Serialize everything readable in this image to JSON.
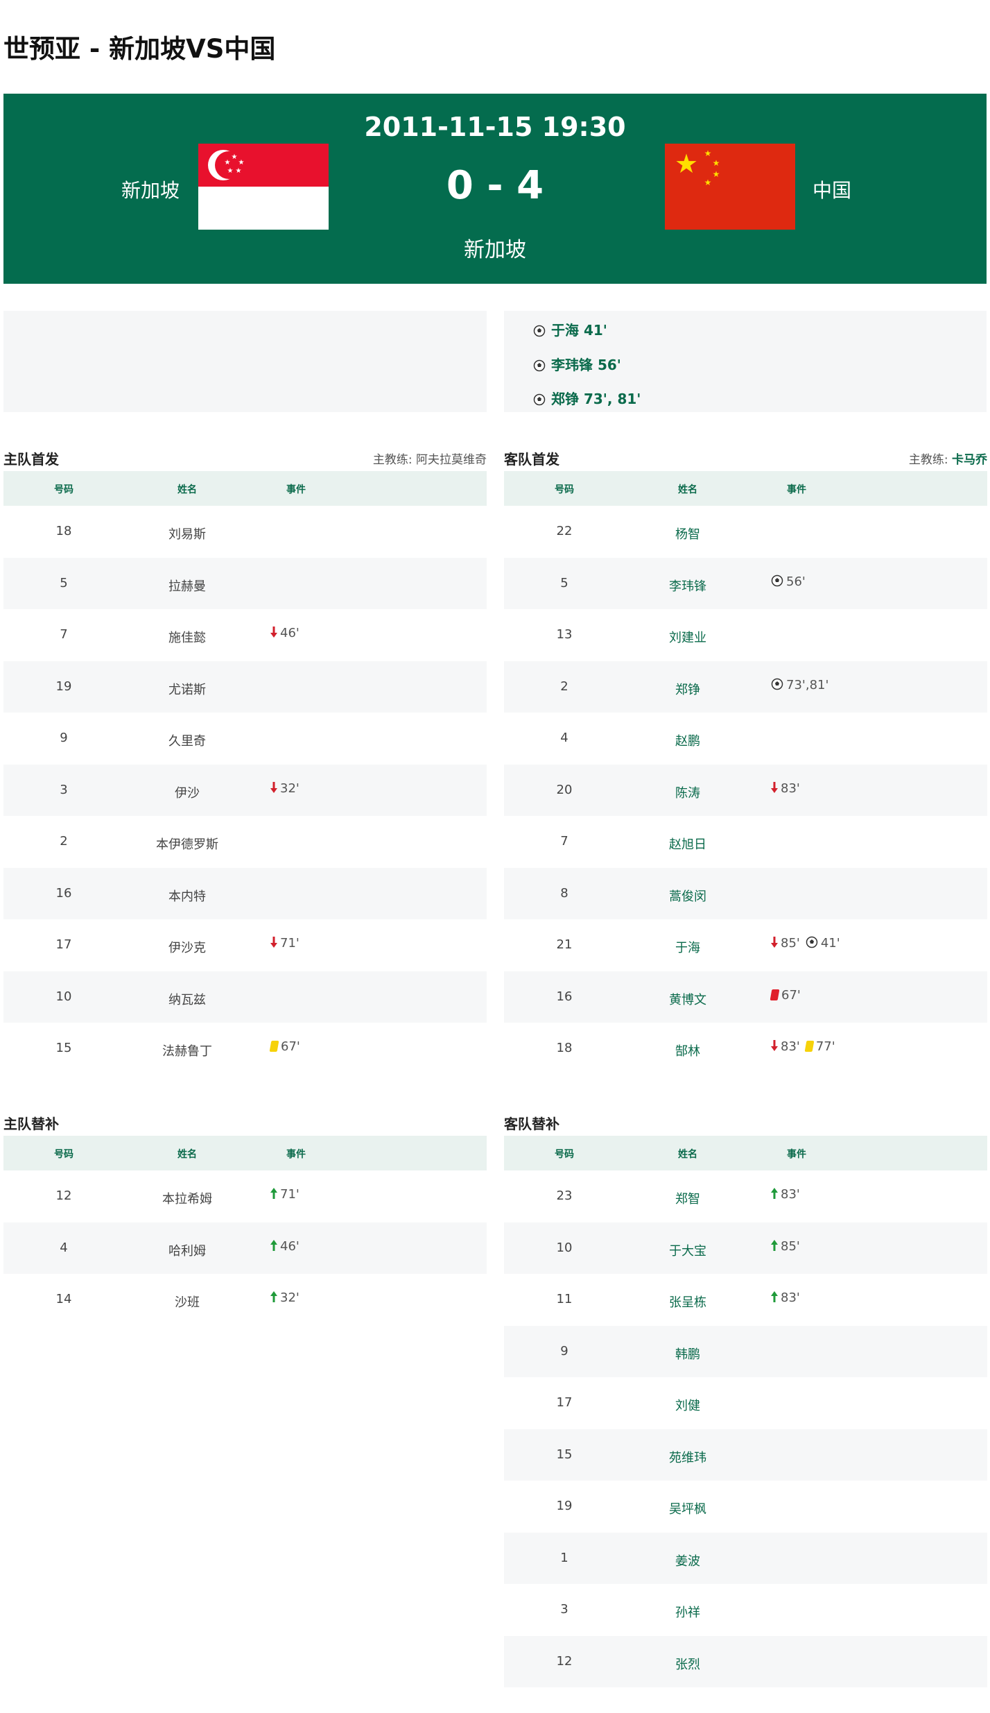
{
  "page_title": "世预亚 - 新加坡VS中国",
  "match": {
    "datetime": "2011-11-15 19:30",
    "score": "0 - 4",
    "venue": "新加坡",
    "home_team": "新加坡",
    "away_team": "中国"
  },
  "colors": {
    "header_bg": "#046c4e",
    "accent": "#0a6a4b",
    "table_head_bg": "#e9f2ef"
  },
  "away_goals": [
    {
      "text": "于海 41'"
    },
    {
      "text": "李玮锋 56'"
    },
    {
      "text": "郑铮 73', 81'"
    }
  ],
  "home_lineup": {
    "title": "主队首发",
    "coach_label": "主教练: 阿夫拉莫维奇",
    "headers": {
      "num": "号码",
      "name": "姓名",
      "event": "事件"
    },
    "rows": [
      {
        "num": "18",
        "name": "刘易斯",
        "events": []
      },
      {
        "num": "5",
        "name": "拉赫曼",
        "events": []
      },
      {
        "num": "7",
        "name": "施佳懿",
        "events": [
          {
            "icon": "sub-out-icon",
            "text": "46'"
          }
        ]
      },
      {
        "num": "19",
        "name": "尤诺斯",
        "events": []
      },
      {
        "num": "9",
        "name": "久里奇",
        "events": []
      },
      {
        "num": "3",
        "name": "伊沙",
        "events": [
          {
            "icon": "sub-out-icon",
            "text": "32'"
          }
        ]
      },
      {
        "num": "2",
        "name": "本伊德罗斯",
        "events": []
      },
      {
        "num": "16",
        "name": "本内特",
        "events": []
      },
      {
        "num": "17",
        "name": "伊沙克",
        "events": [
          {
            "icon": "sub-out-icon",
            "text": "71'"
          }
        ]
      },
      {
        "num": "10",
        "name": "纳瓦兹",
        "events": []
      },
      {
        "num": "15",
        "name": "法赫鲁丁",
        "events": [
          {
            "icon": "yellow-card-icon",
            "text": "67'"
          }
        ]
      }
    ]
  },
  "away_lineup": {
    "title": "客队首发",
    "coach_label": "主教练: ",
    "coach_name": "卡马乔",
    "headers": {
      "num": "号码",
      "name": "姓名",
      "event": "事件"
    },
    "rows": [
      {
        "num": "22",
        "name": "杨智",
        "events": []
      },
      {
        "num": "5",
        "name": "李玮锋",
        "events": [
          {
            "icon": "goal-ball-icon",
            "text": "56'"
          }
        ]
      },
      {
        "num": "13",
        "name": "刘建业",
        "events": []
      },
      {
        "num": "2",
        "name": "郑铮",
        "events": [
          {
            "icon": "goal-ball-icon",
            "text": "73',81'"
          }
        ]
      },
      {
        "num": "4",
        "name": "赵鹏",
        "events": []
      },
      {
        "num": "20",
        "name": "陈涛",
        "events": [
          {
            "icon": "sub-out-icon",
            "text": "83'"
          }
        ]
      },
      {
        "num": "7",
        "name": "赵旭日",
        "events": []
      },
      {
        "num": "8",
        "name": "蒿俊闵",
        "events": []
      },
      {
        "num": "21",
        "name": "于海",
        "events": [
          {
            "icon": "sub-out-icon",
            "text": "85'"
          },
          {
            "icon": "goal-ball-icon",
            "text": "41'"
          }
        ]
      },
      {
        "num": "16",
        "name": "黄博文",
        "events": [
          {
            "icon": "red-card-icon",
            "text": "67'"
          }
        ]
      },
      {
        "num": "18",
        "name": "郜林",
        "events": [
          {
            "icon": "sub-out-icon",
            "text": "83'"
          },
          {
            "icon": "yellow-card-icon",
            "text": "77'"
          }
        ]
      }
    ]
  },
  "home_subs": {
    "title": "主队替补",
    "headers": {
      "num": "号码",
      "name": "姓名",
      "event": "事件"
    },
    "rows": [
      {
        "num": "12",
        "name": "本拉希姆",
        "events": [
          {
            "icon": "sub-in-icon",
            "text": "71'"
          }
        ]
      },
      {
        "num": "4",
        "name": "哈利姆",
        "events": [
          {
            "icon": "sub-in-icon",
            "text": "46'"
          }
        ]
      },
      {
        "num": "14",
        "name": "沙班",
        "events": [
          {
            "icon": "sub-in-icon",
            "text": "32'"
          }
        ]
      }
    ]
  },
  "away_subs": {
    "title": "客队替补",
    "headers": {
      "num": "号码",
      "name": "姓名",
      "event": "事件"
    },
    "rows": [
      {
        "num": "23",
        "name": "郑智",
        "events": [
          {
            "icon": "sub-in-icon",
            "text": "83'"
          }
        ]
      },
      {
        "num": "10",
        "name": "于大宝",
        "events": [
          {
            "icon": "sub-in-icon",
            "text": "85'"
          }
        ]
      },
      {
        "num": "11",
        "name": "张呈栋",
        "events": [
          {
            "icon": "sub-in-icon",
            "text": "83'"
          }
        ]
      },
      {
        "num": "9",
        "name": "韩鹏",
        "events": []
      },
      {
        "num": "17",
        "name": "刘健",
        "events": []
      },
      {
        "num": "15",
        "name": "苑维玮",
        "events": []
      },
      {
        "num": "19",
        "name": "吴坪枫",
        "events": []
      },
      {
        "num": "1",
        "name": "姜波",
        "events": []
      },
      {
        "num": "3",
        "name": "孙祥",
        "events": []
      },
      {
        "num": "12",
        "name": "张烈",
        "events": []
      }
    ]
  }
}
